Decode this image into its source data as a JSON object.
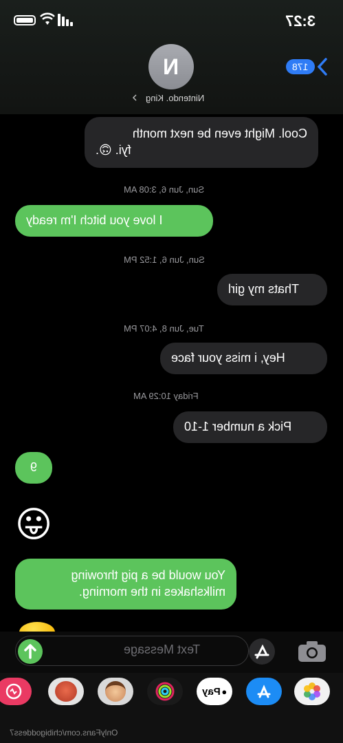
{
  "status_bar": {
    "time": "3:27"
  },
  "header": {
    "avatar_initial": "N",
    "contact_name": "Nintendo. King",
    "back_badge": "178"
  },
  "messages": [
    {
      "type": "received",
      "text_line1": "Cool. Might even be next month",
      "text_line2": "fyi. 🙃."
    },
    {
      "type": "timestamp",
      "text": "Sun, Jun 6, 3:08 AM"
    },
    {
      "type": "sent",
      "text": "I love you bitch I'm ready"
    },
    {
      "type": "timestamp",
      "text": "Sun, Jun 6, 1:52 PM"
    },
    {
      "type": "received",
      "text": "Thats my girl"
    },
    {
      "type": "timestamp",
      "text": "Tue, Jun 8, 4:07 PM"
    },
    {
      "type": "received",
      "text": "Hey, i miss your face"
    },
    {
      "type": "timestamp",
      "text": "Friday 10:29 AM"
    },
    {
      "type": "received",
      "text": "Pick a number 1-10"
    },
    {
      "type": "sent",
      "text": "9"
    },
    {
      "type": "sent_emoji",
      "text": "😛"
    },
    {
      "type": "sent",
      "text_line1": "You would be a pig throwing",
      "text_line2": "milkshakes in the morning."
    }
  ],
  "composer": {
    "placeholder": "Text Message"
  },
  "app_drawer": {
    "apps": [
      {
        "name": "photos-icon"
      },
      {
        "name": "app-store-icon"
      },
      {
        "name": "apple-pay-icon",
        "label": "Pay"
      },
      {
        "name": "activity-icon"
      },
      {
        "name": "memoji-icon"
      },
      {
        "name": "animoji-icon"
      },
      {
        "name": "digital-touch-icon"
      }
    ]
  },
  "watermark": "OnlyFans.com/chibigoddess7",
  "colors": {
    "sent": "#5cc45c",
    "received": "#262628",
    "accent": "#2f7cf6"
  }
}
